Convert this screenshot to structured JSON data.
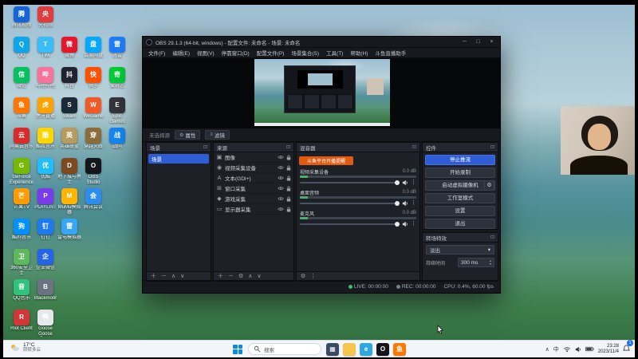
{
  "desktop": {
    "icons": [
      {
        "col": 0,
        "row": 0,
        "label": "腾讯视频",
        "color": "#1565d8",
        "glyph": "腾"
      },
      {
        "col": 1,
        "row": 0,
        "label": "央视频",
        "color": "#e03c3c",
        "glyph": "央"
      },
      {
        "col": 0,
        "row": 1,
        "label": "QQ",
        "color": "#0ea5e9",
        "glyph": "Q"
      },
      {
        "col": 1,
        "row": 1,
        "label": "TIM",
        "color": "#38bdf8",
        "glyph": "T"
      },
      {
        "col": 2,
        "row": 1,
        "label": "微博",
        "color": "#e6162d",
        "glyph": "微"
      },
      {
        "col": 3,
        "row": 1,
        "label": "百度网盘",
        "color": "#06a7ff",
        "glyph": "盘"
      },
      {
        "col": 4,
        "row": 1,
        "label": "迅雷",
        "color": "#1d7dfa",
        "glyph": "雷"
      },
      {
        "col": 0,
        "row": 2,
        "label": "微信",
        "color": "#07c160",
        "glyph": "信"
      },
      {
        "col": 1,
        "row": 2,
        "label": "哔哩哔哩",
        "color": "#fb7299",
        "glyph": "哔"
      },
      {
        "col": 2,
        "row": 2,
        "label": "抖音",
        "color": "#1f2430",
        "glyph": "抖"
      },
      {
        "col": 3,
        "row": 2,
        "label": "快手",
        "color": "#ff5000",
        "glyph": "快"
      },
      {
        "col": 4,
        "row": 2,
        "label": "爱奇艺",
        "color": "#00cc36",
        "glyph": "奇"
      },
      {
        "col": 0,
        "row": 3,
        "label": "斗鱼",
        "color": "#ff7700",
        "glyph": "鱼"
      },
      {
        "col": 1,
        "row": 3,
        "label": "虎牙直播",
        "color": "#ffa200",
        "glyph": "虎"
      },
      {
        "col": 2,
        "row": 3,
        "label": "Steam",
        "color": "#1b2838",
        "glyph": "S"
      },
      {
        "col": 3,
        "row": 3,
        "label": "WeGame",
        "color": "#f05a28",
        "glyph": "W"
      },
      {
        "col": 4,
        "row": 3,
        "label": "Epic Games",
        "color": "#34343c",
        "glyph": "E"
      },
      {
        "col": 0,
        "row": 4,
        "label": "网易云音乐",
        "color": "#d92b2b",
        "glyph": "云"
      },
      {
        "col": 1,
        "row": 4,
        "label": "酷我音乐",
        "color": "#ffd500",
        "glyph": "酷"
      },
      {
        "col": 2,
        "row": 4,
        "label": "英雄联盟",
        "color": "#b79a5e",
        "glyph": "英"
      },
      {
        "col": 3,
        "row": 4,
        "label": "穿越火线",
        "color": "#8a6d3b",
        "glyph": "穿"
      },
      {
        "col": 4,
        "row": 4,
        "label": "战网",
        "color": "#1486f2",
        "glyph": "战"
      },
      {
        "col": 0,
        "row": 5,
        "label": "GeForce Experience",
        "color": "#76b900",
        "glyph": "G"
      },
      {
        "col": 1,
        "row": 5,
        "label": "优酷",
        "color": "#1ebeff",
        "glyph": "优"
      },
      {
        "col": 2,
        "row": 5,
        "label": "地下城与勇士",
        "color": "#7c4a1e",
        "glyph": "D"
      },
      {
        "col": 3,
        "row": 5,
        "label": "OBS Studio",
        "color": "#15161c",
        "glyph": "O"
      },
      {
        "col": 0,
        "row": 6,
        "label": "芒果TV",
        "color": "#ff9a00",
        "glyph": "芒"
      },
      {
        "col": 1,
        "row": 6,
        "label": "PLAYLIST",
        "color": "#7c3aed",
        "glyph": "P"
      },
      {
        "col": 2,
        "row": 6,
        "label": "MuMu模拟器",
        "color": "#ffb400",
        "glyph": "M"
      },
      {
        "col": 3,
        "row": 6,
        "label": "腾讯会议",
        "color": "#2d8cf0",
        "glyph": "会"
      },
      {
        "col": 0,
        "row": 7,
        "label": "酷狗音乐",
        "color": "#0090ff",
        "glyph": "狗"
      },
      {
        "col": 1,
        "row": 7,
        "label": "钉钉",
        "color": "#1e7af0",
        "glyph": "钉"
      },
      {
        "col": 2,
        "row": 7,
        "label": "雷电模拟器",
        "color": "#38a6f5",
        "glyph": "雷"
      },
      {
        "col": 0,
        "row": 8,
        "label": "360安全卫士",
        "color": "#5eb95e",
        "glyph": "卫"
      },
      {
        "col": 1,
        "row": 8,
        "label": "企业微信",
        "color": "#2563eb",
        "glyph": "企"
      },
      {
        "col": 0,
        "row": 9,
        "label": "QQ音乐",
        "color": "#31c27c",
        "glyph": "音"
      },
      {
        "col": 1,
        "row": 9,
        "label": "Blackmoor",
        "color": "#6b7280",
        "glyph": "B"
      },
      {
        "col": 0,
        "row": 10,
        "label": "Riot Client",
        "color": "#d13639",
        "glyph": "R"
      },
      {
        "col": 1,
        "row": 10,
        "label": "Goose Goose Duck",
        "color": "#e5e7eb",
        "glyph": "鸭"
      }
    ]
  },
  "obs": {
    "dock_icon": "⊡",
    "titlebar": {
      "title": "OBS 29.1.3 (64-bit, windows) - 配置文件: 未命名 - 场景: 未命名",
      "buttons": [
        "─",
        "□",
        "×"
      ]
    },
    "menu": [
      "文件(F)",
      "编辑(E)",
      "视图(V)",
      "停靠窗口(D)",
      "配置文件(P)",
      "场景集合(S)",
      "工具(T)",
      "帮助(H)",
      "斗鱼直播助手"
    ],
    "source_toolbar": {
      "no_source_text": "未选择源",
      "properties_glyph": "⚙",
      "properties_label": "属性",
      "filters_glyph": "≡",
      "filters_label": "滤镜"
    },
    "docks": {
      "scenes": {
        "title": "场景",
        "items": [
          {
            "label": "场景"
          }
        ],
        "toolbar": [
          "＋",
          "－",
          "∧",
          "∨"
        ]
      },
      "sources": {
        "title": "来源",
        "items": [
          {
            "glyph": "▣",
            "label": "图像"
          },
          {
            "glyph": "◉",
            "label": "视频采集设备"
          },
          {
            "glyph": "A",
            "label": "文本(GDI+)"
          },
          {
            "glyph": "⊞",
            "label": "窗口采集"
          },
          {
            "glyph": "◆",
            "label": "游戏采集"
          },
          {
            "glyph": "▭",
            "label": "显示器采集"
          }
        ],
        "toolbar": [
          "＋",
          "－",
          "⚙",
          "∧",
          "∨"
        ]
      },
      "mixer": {
        "title": "混音器",
        "banner": "斗鱼平台开播提醒",
        "channels": [
          {
            "name": "视频采集设备",
            "db": "0.0 dB"
          },
          {
            "name": "桌面音频",
            "db": "0.0 dB"
          },
          {
            "name": "麦克风",
            "db": "0.0 dB"
          }
        ],
        "toolbar": [
          "⚙",
          "⋮"
        ]
      },
      "controls": {
        "title": "控件",
        "buttons": [
          "停止推流",
          "开始录制",
          "启动虚拟摄像机",
          "工作室模式",
          "设置",
          "退出"
        ],
        "vcam_gear_glyph": "⚙"
      },
      "transitions": {
        "title": "转场特效",
        "selected": "淡出",
        "chevron": "▾",
        "duration_label": "持续时间",
        "duration_value": "300 ms"
      }
    },
    "statusbar": {
      "live_label": "LIVE: 00:00:00",
      "rec_label": "REC: 00:00:00",
      "cpu_label": "CPU: 0.4%, 60.00 fps"
    }
  },
  "taskbar": {
    "weather": {
      "temp": "17°C",
      "desc": "阴转多云"
    },
    "search_label": "搜索",
    "apps": [
      {
        "name": "任务视图",
        "color": "#394b63",
        "glyph": "▦"
      },
      {
        "name": "文件资源管理器",
        "color": "#f3c64e",
        "glyph": ""
      },
      {
        "name": "Microsoft Edge",
        "color": "#2fa8e0",
        "glyph": "e"
      },
      {
        "name": "OBS Studio",
        "color": "#15161c",
        "glyph": "O"
      },
      {
        "name": "斗鱼直播伴侣",
        "color": "#ff7700",
        "glyph": "鱼"
      }
    ],
    "tray": {
      "chevron": "∧",
      "ime": "中",
      "time": "23:28",
      "date": "2023/11/4",
      "badge": "1"
    }
  }
}
